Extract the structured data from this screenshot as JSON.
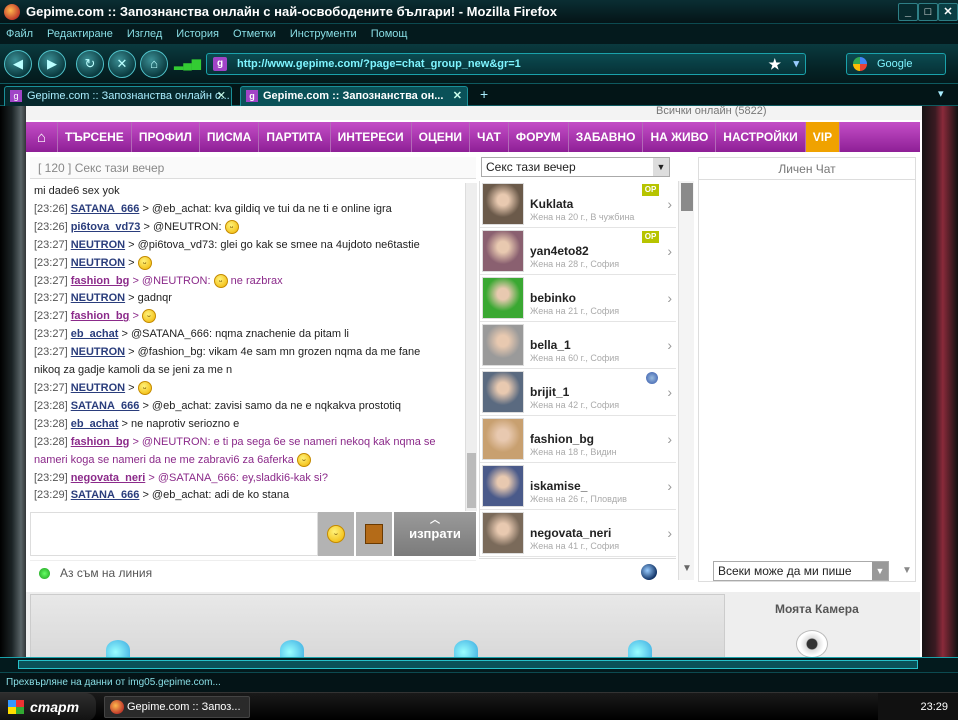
{
  "window": {
    "title": "Gepime.com :: Запознанства онлайн с най-освободените българи! - Mozilla Firefox"
  },
  "menu": [
    "Файл",
    "Редактиране",
    "Изглед",
    "История",
    "Отметки",
    "Инструменти",
    "Помощ"
  ],
  "address": {
    "url": "http://www.gepime.com/?page=chat_group_new&gr=1"
  },
  "search": {
    "engine": "Google"
  },
  "tabs": [
    {
      "label": "Gepime.com :: Запознанства онлайн с..."
    },
    {
      "label": "Gepime.com :: Запознанства он..."
    }
  ],
  "page_top": {
    "online": "Всички онлайн  (5822)"
  },
  "nav": [
    "ТЪРСЕНЕ",
    "ПРОФИЛ",
    "ПИСМА",
    "ПАРТИТА",
    "ИНТЕРЕСИ",
    "ОЦЕНИ",
    "ЧАТ",
    "ФОРУМ",
    "ЗАБАВНО",
    "НА ЖИВО",
    "НАСТРОЙКИ",
    "VIP"
  ],
  "chat": {
    "room_header": "[ 120 ]  Секс тази вечер",
    "room_select": "Секс тази вечер",
    "send": "изпрати",
    "status": "Аз съм на линия"
  },
  "messages": [
    {
      "time": "",
      "user": "",
      "text": "mi dade6 sex yok",
      "f": false,
      "smile": false
    },
    {
      "time": "[23:26]",
      "user": "SATANA_666",
      "text": "> @eb_achat:  kva gildiq ve tui da ne ti e online igra",
      "f": false,
      "smile": false
    },
    {
      "time": "[23:26]",
      "user": "pi6tova_vd73",
      "text": "> @NEUTRON:",
      "f": false,
      "smile": true
    },
    {
      "time": "[23:27]",
      "user": "NEUTRON",
      "text": "> @pi6tova_vd73: glei go kak se smee na 4ujdoto ne6tastie",
      "f": false,
      "smile": false
    },
    {
      "time": "[23:27]",
      "user": "NEUTRON",
      "text": ">",
      "f": false,
      "smile": true
    },
    {
      "time": "[23:27]",
      "user": "fashion_bg",
      "text": "> @NEUTRON:",
      "f": true,
      "smile": true,
      "after": "ne razbrax"
    },
    {
      "time": "[23:27]",
      "user": "NEUTRON",
      "text": "> gadnqr",
      "f": false,
      "smile": false
    },
    {
      "time": "[23:27]",
      "user": "fashion_bg",
      "text": ">",
      "f": true,
      "smile": true
    },
    {
      "time": "[23:27]",
      "user": "eb_achat",
      "text": "> @SATANA_666: nqma  znachenie  da  pitam li",
      "f": false,
      "smile": false
    },
    {
      "time": "[23:27]",
      "user": "NEUTRON",
      "text": "> @fashion_bg: vikam 4e sam mn grozen  nqma da me fane",
      "f": false,
      "smile": false
    },
    {
      "time": "",
      "user": "",
      "text": "nikoq za gadje kamoli da se jeni za me n",
      "f": false,
      "smile": false
    },
    {
      "time": "[23:27]",
      "user": "NEUTRON",
      "text": ">",
      "f": false,
      "smile": true
    },
    {
      "time": "[23:28]",
      "user": "SATANA_666",
      "text": "> @eb_achat:  zavisi samo da ne e nqkakva prostotiq",
      "f": false,
      "smile": false
    },
    {
      "time": "[23:28]",
      "user": "eb_achat",
      "text": "> ne  naprotiv  seriozno  e",
      "f": false,
      "smile": false
    },
    {
      "time": "[23:28]",
      "user": "fashion_bg",
      "text": "> @NEUTRON: e ti pa sega 6e se nameri nekoq kak nqma se",
      "f": true,
      "smile": false
    },
    {
      "time": "",
      "user": "",
      "text": "nameri koga se nameri da ne me zabravi6 za 6aferka",
      "f": true,
      "smile": true
    },
    {
      "time": "[23:29]",
      "user": "negovata_neri",
      "text": "> @SATANA_666: ey,sladki6-kak si?",
      "f": true,
      "smile": false
    },
    {
      "time": "[23:29]",
      "user": "SATANA_666",
      "text": "> @eb_achat:  adi de ko stana",
      "f": false,
      "smile": false
    }
  ],
  "users": [
    {
      "name": "Kuklata",
      "info": "Жена на 20 г., В чужбина",
      "op": "OP",
      "color": "#6b5a4a"
    },
    {
      "name": "yan4eto82",
      "info": "Жена на 28 г., София",
      "op": "OP",
      "color": "#8a6070"
    },
    {
      "name": "bebinko",
      "info": "Жена на 21 г., София",
      "op": "",
      "color": "#3aa832"
    },
    {
      "name": "bella_1",
      "info": "Жена на 60 г., София",
      "op": "",
      "color": "#9a9a9a"
    },
    {
      "name": "brijit_1",
      "info": "Жена на 42 г., София",
      "op": "",
      "color": "#5a6a80"
    },
    {
      "name": "fashion_bg",
      "info": "Жена на 18 г., Видин",
      "op": "",
      "color": "#c8a070"
    },
    {
      "name": "iskamise_",
      "info": "Жена на 26 г., Пловдив",
      "op": "",
      "color": "#4a5a8a"
    },
    {
      "name": "negovata_neri",
      "info": "Жена на 41 г., София",
      "op": "",
      "color": "#7a6a5a"
    }
  ],
  "private_chat": {
    "title": "Личен Чат",
    "select": "Всеки може да ми пише"
  },
  "camera": {
    "title": "Моята Камера"
  },
  "statusbar": {
    "text": "Прехвърляне на данни от img05.gepime.com..."
  },
  "taskbar": {
    "start": "старт",
    "item": "Gepime.com :: Запоз...",
    "clock": "23:29"
  }
}
